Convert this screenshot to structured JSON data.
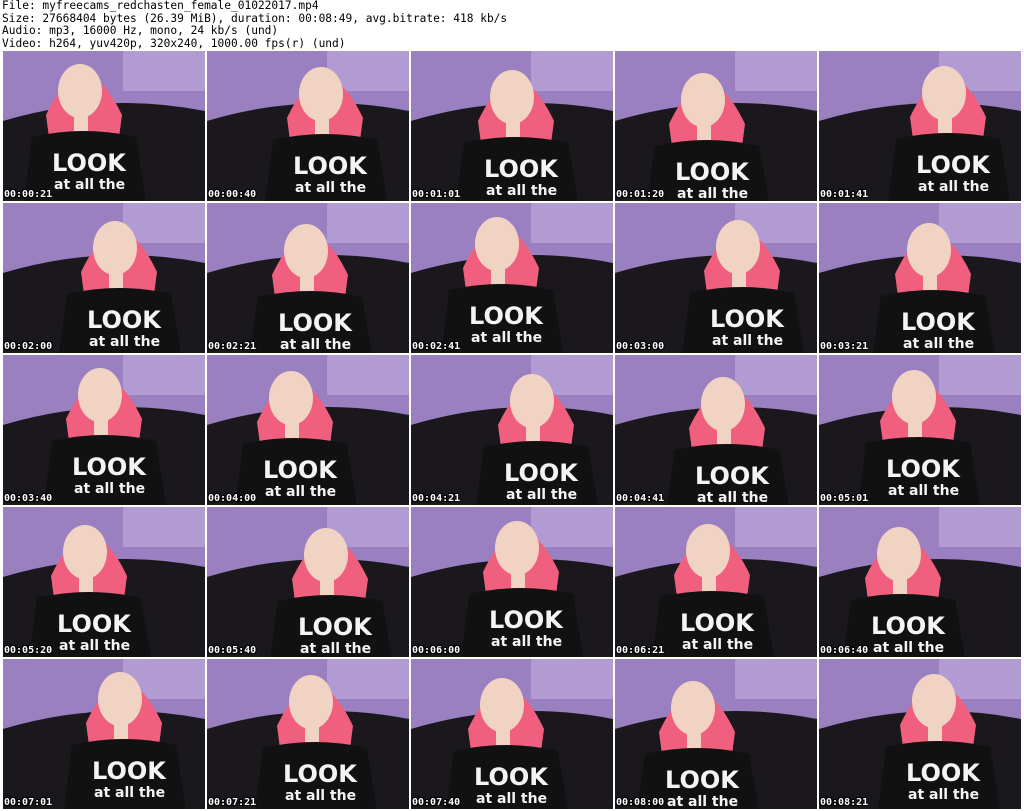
{
  "header": {
    "file": "File: myfreecams_redchasten_female_01022017.mp4",
    "size": "Size: 27668404 bytes (26.39 MiB), duration: 00:08:49, avg.bitrate: 418 kb/s",
    "audio": "Audio: mp3, 16000 Hz, mono, 24 kb/s (und)",
    "video": "Video: h264, yuv420p, 320x240, 1000.00 fps(r) (und)"
  },
  "thumbnails": [
    {
      "timestamp": "00:00:21"
    },
    {
      "timestamp": "00:00:40"
    },
    {
      "timestamp": "00:01:01"
    },
    {
      "timestamp": "00:01:20"
    },
    {
      "timestamp": "00:01:41"
    },
    {
      "timestamp": "00:02:00"
    },
    {
      "timestamp": "00:02:21"
    },
    {
      "timestamp": "00:02:41"
    },
    {
      "timestamp": "00:03:00"
    },
    {
      "timestamp": "00:03:21"
    },
    {
      "timestamp": "00:03:40"
    },
    {
      "timestamp": "00:04:00"
    },
    {
      "timestamp": "00:04:21"
    },
    {
      "timestamp": "00:04:41"
    },
    {
      "timestamp": "00:05:01"
    },
    {
      "timestamp": "00:05:20"
    },
    {
      "timestamp": "00:05:40"
    },
    {
      "timestamp": "00:06:00"
    },
    {
      "timestamp": "00:06:21"
    },
    {
      "timestamp": "00:06:40"
    },
    {
      "timestamp": "00:07:01"
    },
    {
      "timestamp": "00:07:21"
    },
    {
      "timestamp": "00:07:40"
    },
    {
      "timestamp": "00:08:00"
    },
    {
      "timestamp": "00:08:21"
    }
  ],
  "shirt_text": [
    "LOOK",
    "at all the"
  ],
  "colors": {
    "hair": "#f0607e",
    "skin": "#f1d3c4",
    "shirt": "#111111",
    "wall": "#9a80c0"
  }
}
